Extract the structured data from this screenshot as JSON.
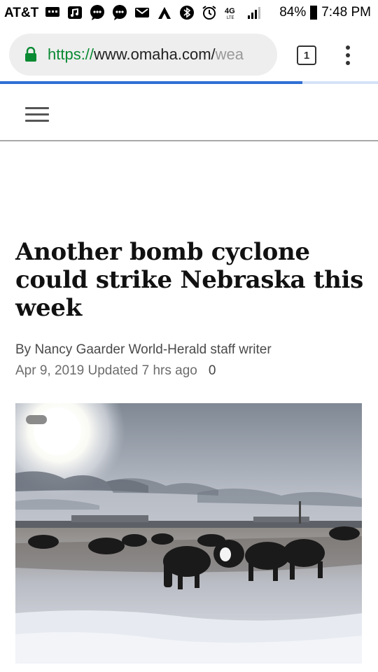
{
  "status_bar": {
    "carrier": "AT&T",
    "battery": "84%",
    "time": "7:48 PM",
    "network": "4G LTE",
    "icons": [
      "message-icon",
      "music-icon",
      "chat-icon",
      "chat-icon",
      "gmail-icon",
      "app-icon",
      "bluetooth-icon",
      "alarm-icon",
      "lte-icon",
      "signal-icon",
      "battery-icon"
    ]
  },
  "browser": {
    "url_scheme": "https://",
    "url_host": "www.omaha.com/",
    "url_tail": "wea",
    "tab_count": "1",
    "load_progress": 0.8
  },
  "article": {
    "headline": "Another bomb cyclone could strike Nebraska this week",
    "byline": "By Nancy Gaarder World-Herald staff writer",
    "date": "Apr 9, 2019 Updated 7 hrs ago",
    "comments": "0"
  },
  "colors": {
    "secure_green": "#0a8a33",
    "progress_blue": "#2f6fd4"
  }
}
